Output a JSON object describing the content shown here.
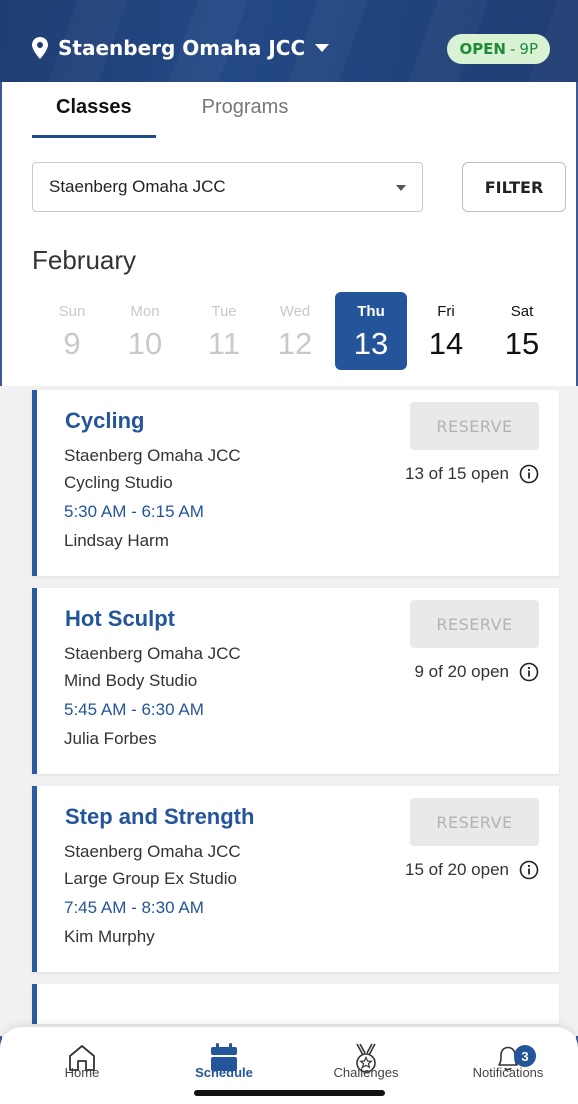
{
  "header": {
    "location": "Staenberg Omaha JCC",
    "status": "OPEN",
    "separator": "-",
    "hours": "9P"
  },
  "tabs": [
    {
      "label": "Classes",
      "active": true
    },
    {
      "label": "Programs",
      "active": false
    }
  ],
  "location_select": {
    "value": "Staenberg Omaha JCC"
  },
  "filter_label": "FILTER",
  "month": "February",
  "days": [
    {
      "name": "Sun",
      "num": "9",
      "state": "past"
    },
    {
      "name": "Mon",
      "num": "10",
      "state": "past"
    },
    {
      "name": "Tue",
      "num": "11",
      "state": "past"
    },
    {
      "name": "Wed",
      "num": "12",
      "state": "past"
    },
    {
      "name": "Thu",
      "num": "13",
      "state": "selected"
    },
    {
      "name": "Fri",
      "num": "14",
      "state": "future"
    },
    {
      "name": "Sat",
      "num": "15",
      "state": "future"
    }
  ],
  "classes": [
    {
      "title": "Cycling",
      "gym": "Staenberg Omaha JCC",
      "room": "Cycling Studio",
      "time": "5:30 AM - 6:15 AM",
      "instructor": "Lindsay Harm",
      "reserve": "RESERVE",
      "availability": "13 of 15 open"
    },
    {
      "title": "Hot Sculpt",
      "gym": "Staenberg Omaha JCC",
      "room": "Mind Body Studio",
      "time": "5:45 AM - 6:30 AM",
      "instructor": "Julia Forbes",
      "reserve": "RESERVE",
      "availability": "9 of 20 open"
    },
    {
      "title": "Step and Strength",
      "gym": "Staenberg Omaha JCC",
      "room": "Large Group Ex Studio",
      "time": "7:45 AM - 8:30 AM",
      "instructor": "Kim Murphy",
      "reserve": "RESERVE",
      "availability": "15 of 20 open"
    }
  ],
  "nav": [
    {
      "label": "Home",
      "icon": "home-icon",
      "active": false
    },
    {
      "label": "Schedule",
      "icon": "calendar-icon",
      "active": true
    },
    {
      "label": "Challenges",
      "icon": "medal-icon",
      "active": false
    },
    {
      "label": "Notifications",
      "icon": "bell-icon",
      "active": false,
      "badge": "3"
    }
  ],
  "colors": {
    "brand": "#24559a",
    "header_bg": "#1f3d72",
    "open_badge_bg": "#d8f2d3",
    "open_text": "#1f8a3a"
  }
}
